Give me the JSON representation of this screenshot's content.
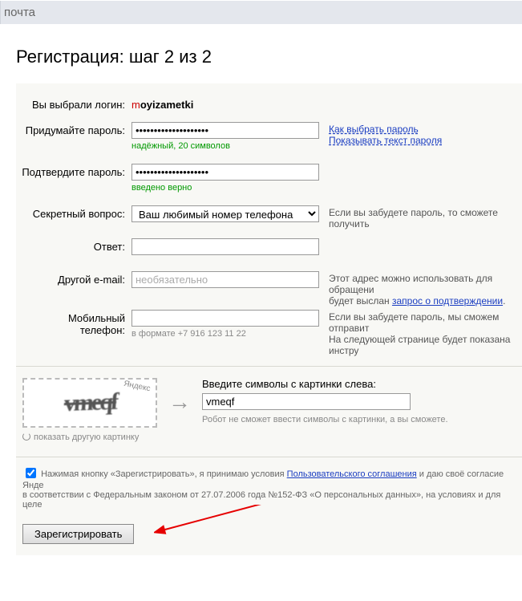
{
  "topbar": {
    "title": "почта"
  },
  "heading": "Регистрация: шаг 2 из 2",
  "login": {
    "label": "Вы выбрали логин:",
    "first_char": "m",
    "rest": "oyizametki"
  },
  "password": {
    "label": "Придумайте пароль:",
    "value": "••••••••••••••••••••",
    "hint": "надёжный, 20 символов",
    "aside_how": "Как выбрать пароль",
    "aside_show": "Показывать текст пароля"
  },
  "confirm": {
    "label": "Подтвердите пароль:",
    "value": "••••••••••••••••••••",
    "hint": "введено верно"
  },
  "secret": {
    "label": "Секретный вопрос:",
    "selected": "Ваш любимый номер телефона",
    "aside": "Если вы забудете пароль, то сможете получить"
  },
  "answer": {
    "label": "Ответ:"
  },
  "other_email": {
    "label": "Другой e-mail:",
    "placeholder": "необязательно",
    "aside_line1": "Этот адрес можно использовать для обращени",
    "aside_line2_pre": "будет выслан ",
    "aside_link": "запрос о подтверждении",
    "aside_line2_post": "."
  },
  "phone": {
    "label": "Мобильный телефон:",
    "hint": "в формате +7 916 123 11 22",
    "aside_line1": "Если вы забудете пароль, мы сможем отправит",
    "aside_line2": "На следующей странице будет показана инстру"
  },
  "captcha": {
    "img_text": "vmeqf",
    "brand": "Яндекс",
    "reload": "показать другую картинку",
    "prompt": "Введите символы с картинки слева:",
    "value": "vmeqf",
    "hint": "Робот не сможет ввести символы с картинки, а вы сможете."
  },
  "agreement": {
    "pre": "Нажимая кнопку «Зарегистрировать», я принимаю условия ",
    "link": "Пользовательского соглашения",
    "post": " и даю своё согласие Янде",
    "line2": "в соответствии с Федеральным законом от 27.07.2006 года №152-ФЗ «О персональных данных», на условиях и для целе"
  },
  "submit": {
    "label": "Зарегистрировать"
  }
}
